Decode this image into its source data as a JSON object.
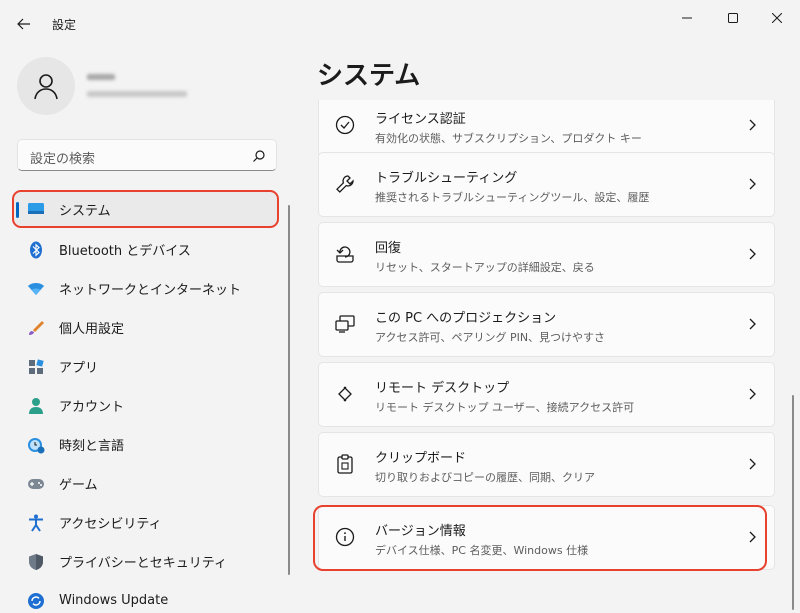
{
  "window": {
    "title": "設定"
  },
  "profile": {
    "name_blurred": "",
    "email_blurred": ""
  },
  "search": {
    "placeholder": "設定の検索"
  },
  "sidebar": {
    "items": [
      {
        "label": "システム",
        "icon": "system-icon",
        "selected": true
      },
      {
        "label": "Bluetooth とデバイス",
        "icon": "bluetooth-icon"
      },
      {
        "label": "ネットワークとインターネット",
        "icon": "network-icon"
      },
      {
        "label": "個人用設定",
        "icon": "personalization-icon"
      },
      {
        "label": "アプリ",
        "icon": "apps-icon"
      },
      {
        "label": "アカウント",
        "icon": "account-icon"
      },
      {
        "label": "時刻と言語",
        "icon": "time-language-icon"
      },
      {
        "label": "ゲーム",
        "icon": "gaming-icon"
      },
      {
        "label": "アクセシビリティ",
        "icon": "accessibility-icon"
      },
      {
        "label": "プライバシーとセキュリティ",
        "icon": "privacy-shield-icon"
      },
      {
        "label": "Windows Update",
        "icon": "windows-update-icon"
      }
    ]
  },
  "main": {
    "title": "システム",
    "cards": [
      {
        "title": "ライセンス認証",
        "subtitle": "有効化の状態、サブスクリプション、プロダクト キー",
        "icon": "activation-check-icon"
      },
      {
        "title": "トラブルシューティング",
        "subtitle": "推奨されるトラブルシューティングツール、設定、履歴",
        "icon": "wrench-icon"
      },
      {
        "title": "回復",
        "subtitle": "リセット、スタートアップの詳細設定、戻る",
        "icon": "recovery-icon"
      },
      {
        "title": "この PC へのプロジェクション",
        "subtitle": "アクセス許可、ペアリング PIN、見つけやすさ",
        "icon": "projection-icon"
      },
      {
        "title": "リモート デスクトップ",
        "subtitle": "リモート デスクトップ ユーザー、接続アクセス許可",
        "icon": "remote-desktop-icon"
      },
      {
        "title": "クリップボード",
        "subtitle": "切り取りおよびコピーの履歴、同期、クリア",
        "icon": "clipboard-icon"
      },
      {
        "title": "バージョン情報",
        "subtitle": "デバイス仕様、PC 名変更、Windows 仕様",
        "icon": "info-icon"
      }
    ]
  },
  "colors": {
    "accent": "#0067c0",
    "highlight": "#e8412e",
    "background": "#f3f3f3",
    "card": "#fbfbfb"
  }
}
